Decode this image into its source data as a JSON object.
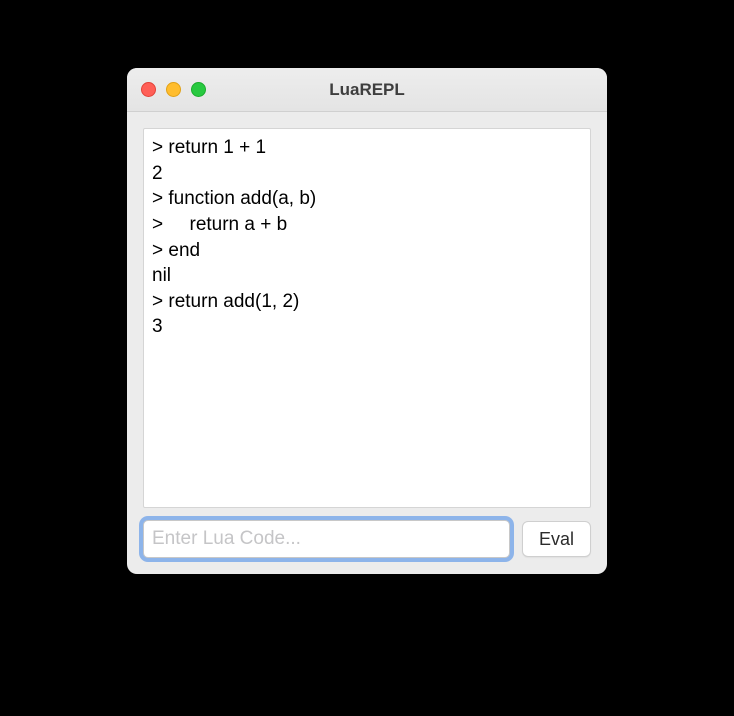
{
  "window": {
    "title": "LuaREPL"
  },
  "output": {
    "lines": [
      "> return 1 + 1",
      "2",
      "> function add(a, b)",
      ">     return a + b",
      "> end",
      "nil",
      "> return add(1, 2)",
      "3"
    ]
  },
  "input": {
    "value": "",
    "placeholder": "Enter Lua Code..."
  },
  "buttons": {
    "eval": "Eval"
  }
}
